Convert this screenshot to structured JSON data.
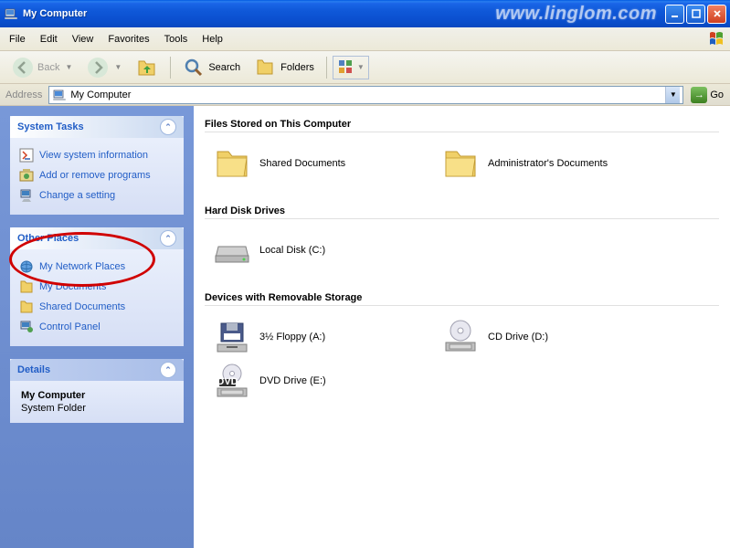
{
  "window": {
    "title": "My Computer"
  },
  "menu": {
    "file": "File",
    "edit": "Edit",
    "view": "View",
    "favorites": "Favorites",
    "tools": "Tools",
    "help": "Help"
  },
  "toolbar": {
    "back": "Back",
    "search": "Search",
    "folders": "Folders"
  },
  "address": {
    "label": "Address",
    "value": "My Computer",
    "go": "Go"
  },
  "sidebar": {
    "systemTasks": {
      "title": "System Tasks",
      "links": {
        "info": "View system information",
        "programs": "Add or remove programs",
        "setting": "Change a setting"
      }
    },
    "otherPlaces": {
      "title": "Other Places",
      "links": {
        "network": "My Network Places",
        "docs": "My Documents",
        "shared": "Shared Documents",
        "cp": "Control Panel"
      }
    },
    "details": {
      "title": "Details",
      "name": "My Computer",
      "type": "System Folder"
    }
  },
  "content": {
    "sections": {
      "files": {
        "title": "Files Stored on This Computer",
        "items": {
          "shared": "Shared Documents",
          "admin": "Administrator's Documents"
        }
      },
      "hdd": {
        "title": "Hard Disk Drives",
        "items": {
          "c": "Local Disk (C:)"
        }
      },
      "removable": {
        "title": "Devices with Removable Storage",
        "items": {
          "floppy": "3½ Floppy (A:)",
          "cd": "CD Drive (D:)",
          "dvd": "DVD Drive (E:)"
        }
      }
    }
  },
  "watermark": "www.linglom.com"
}
